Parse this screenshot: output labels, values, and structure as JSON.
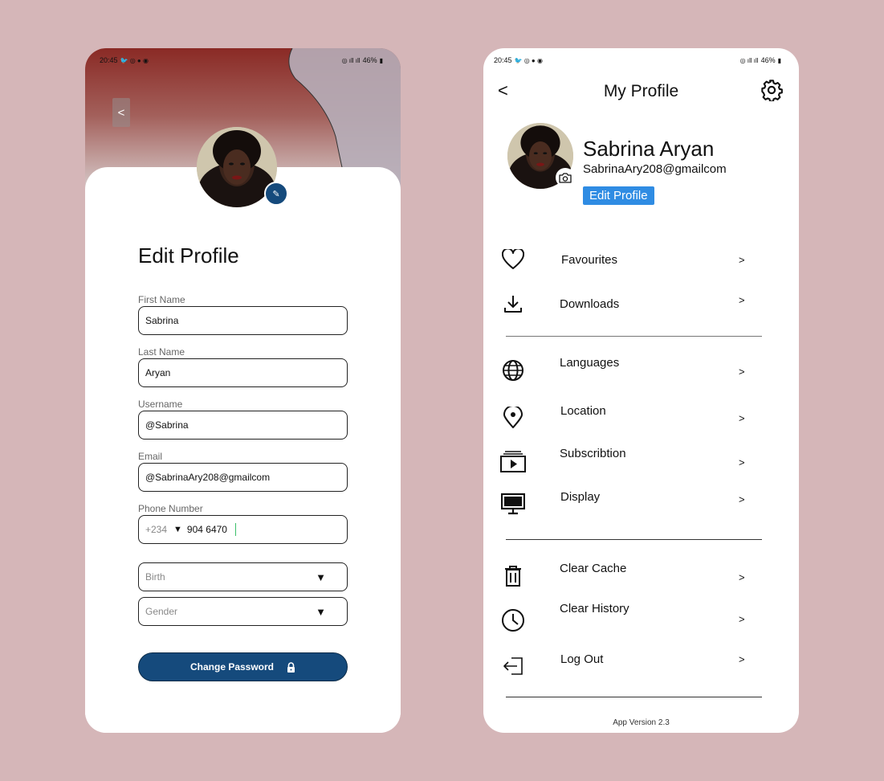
{
  "colors": {
    "background": "#d5b6b8",
    "primary_button": "#154a7c",
    "edit_profile_button": "#2f8ce3",
    "hero_top": "#8a2a25"
  },
  "status_bar": {
    "time": "20:45",
    "battery": "46%"
  },
  "edit_profile": {
    "title": "Edit Profile",
    "back_label": "<",
    "fields": [
      {
        "label": "First Name",
        "value": "Sabrina"
      },
      {
        "label": "Last Name",
        "value": "Aryan"
      },
      {
        "label": "Username",
        "value": "@Sabrina"
      },
      {
        "label": "Email",
        "value": "@SabrinaAry208@gmailcom"
      }
    ],
    "phone": {
      "label": "Phone Number",
      "code": "+234",
      "caret": "▼",
      "value": "904 6470"
    },
    "birth_placeholder": "Birth",
    "gender_placeholder": "Gender",
    "dropdown_caret": "▼",
    "change_password_label": "Change Password"
  },
  "my_profile": {
    "title": "My Profile",
    "back_label": "<",
    "name": "Sabrina Aryan",
    "email": "SabrinaAry208@gmailcom",
    "edit_button_label": "Edit Profile",
    "chevron": ">",
    "menu": [
      {
        "label": "Favourites",
        "icon": "heart-icon"
      },
      {
        "label": "Downloads",
        "icon": "download-icon"
      },
      {
        "label": "Languages",
        "icon": "globe-icon"
      },
      {
        "label": "Location",
        "icon": "location-pin-icon"
      },
      {
        "label": "Subscribtion",
        "icon": "subscription-icon"
      },
      {
        "label": "Display",
        "icon": "monitor-icon"
      },
      {
        "label": "Clear Cache",
        "icon": "trash-icon"
      },
      {
        "label": "Clear History",
        "icon": "clock-icon"
      },
      {
        "label": "Log Out",
        "icon": "logout-icon"
      }
    ],
    "app_version": "App Version 2.3"
  }
}
